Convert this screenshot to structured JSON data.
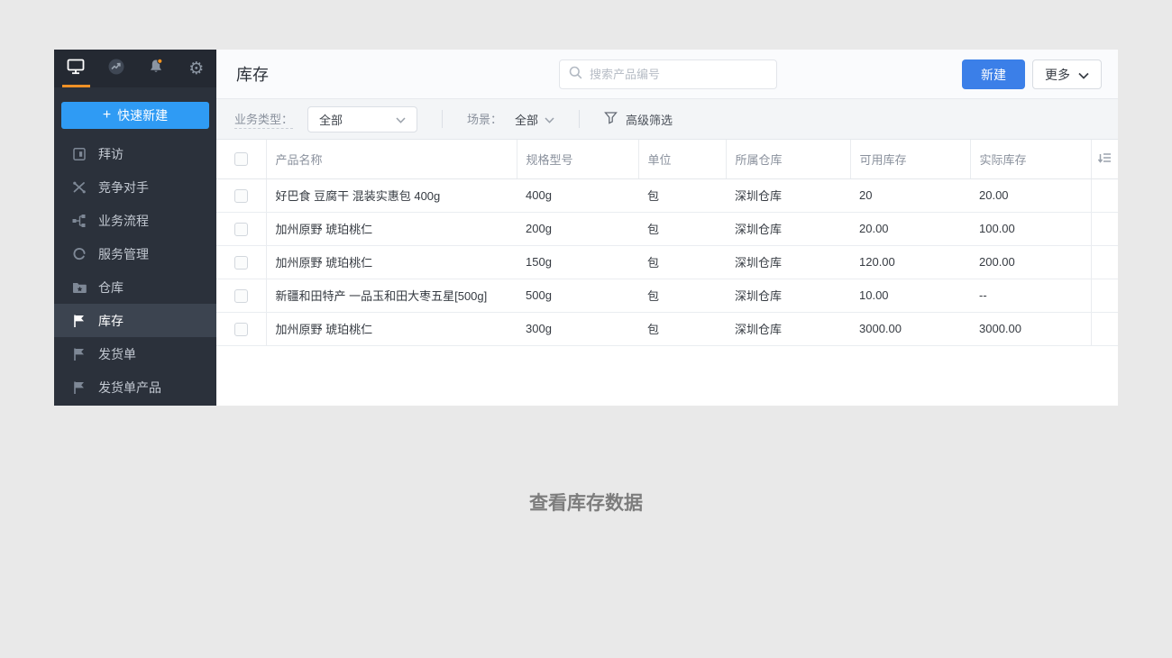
{
  "icons": {
    "plus": "+",
    "gear": "⚙"
  },
  "page": {
    "caption": "查看库存数据"
  },
  "sidebar": {
    "quick_create_label": "快速新建",
    "items": [
      {
        "label": "拜访"
      },
      {
        "label": "竞争对手"
      },
      {
        "label": "业务流程"
      },
      {
        "label": "服务管理"
      },
      {
        "label": "仓库"
      },
      {
        "label": "库存"
      },
      {
        "label": "发货单"
      },
      {
        "label": "发货单产品"
      }
    ]
  },
  "header": {
    "title": "库存",
    "search_placeholder": "搜索产品编号",
    "new_button_label": "新建",
    "more_button_label": "更多"
  },
  "filter_bar": {
    "business_type_label": "业务类型：",
    "business_type_value": "全部",
    "scene_label": "场景：",
    "scene_value": "全部",
    "advanced_filter_label": "高级筛选"
  },
  "table": {
    "columns": [
      "产品名称",
      "规格型号",
      "单位",
      "所属仓库",
      "可用库存",
      "实际库存"
    ],
    "rows": [
      {
        "name": "好巴食 豆腐干 混装实惠包 400g",
        "spec": "400g",
        "unit": "包",
        "warehouse": "深圳仓库",
        "available": "20",
        "actual": "20.00"
      },
      {
        "name": "加州原野 琥珀桃仁",
        "spec": "200g",
        "unit": "包",
        "warehouse": "深圳仓库",
        "available": "20.00",
        "actual": "100.00"
      },
      {
        "name": "加州原野 琥珀桃仁",
        "spec": "150g",
        "unit": "包",
        "warehouse": "深圳仓库",
        "available": "120.00",
        "actual": "200.00"
      },
      {
        "name": "新疆和田特产 一品玉和田大枣五星[500g]",
        "spec": "500g",
        "unit": "包",
        "warehouse": "深圳仓库",
        "available": "10.00",
        "actual": "--"
      },
      {
        "name": "加州原野 琥珀桃仁",
        "spec": "300g",
        "unit": "包",
        "warehouse": "深圳仓库",
        "available": "3000.00",
        "actual": "3000.00"
      }
    ]
  },
  "colors": {
    "accent_blue": "#3b7fe8",
    "quick_create_blue": "#2f9bf4",
    "active_underline_orange": "#ef9126",
    "notification_dot_orange": "#f7941e",
    "sidebar_bg": "#2b313b",
    "sidebar_active_bg": "#3c4450"
  }
}
